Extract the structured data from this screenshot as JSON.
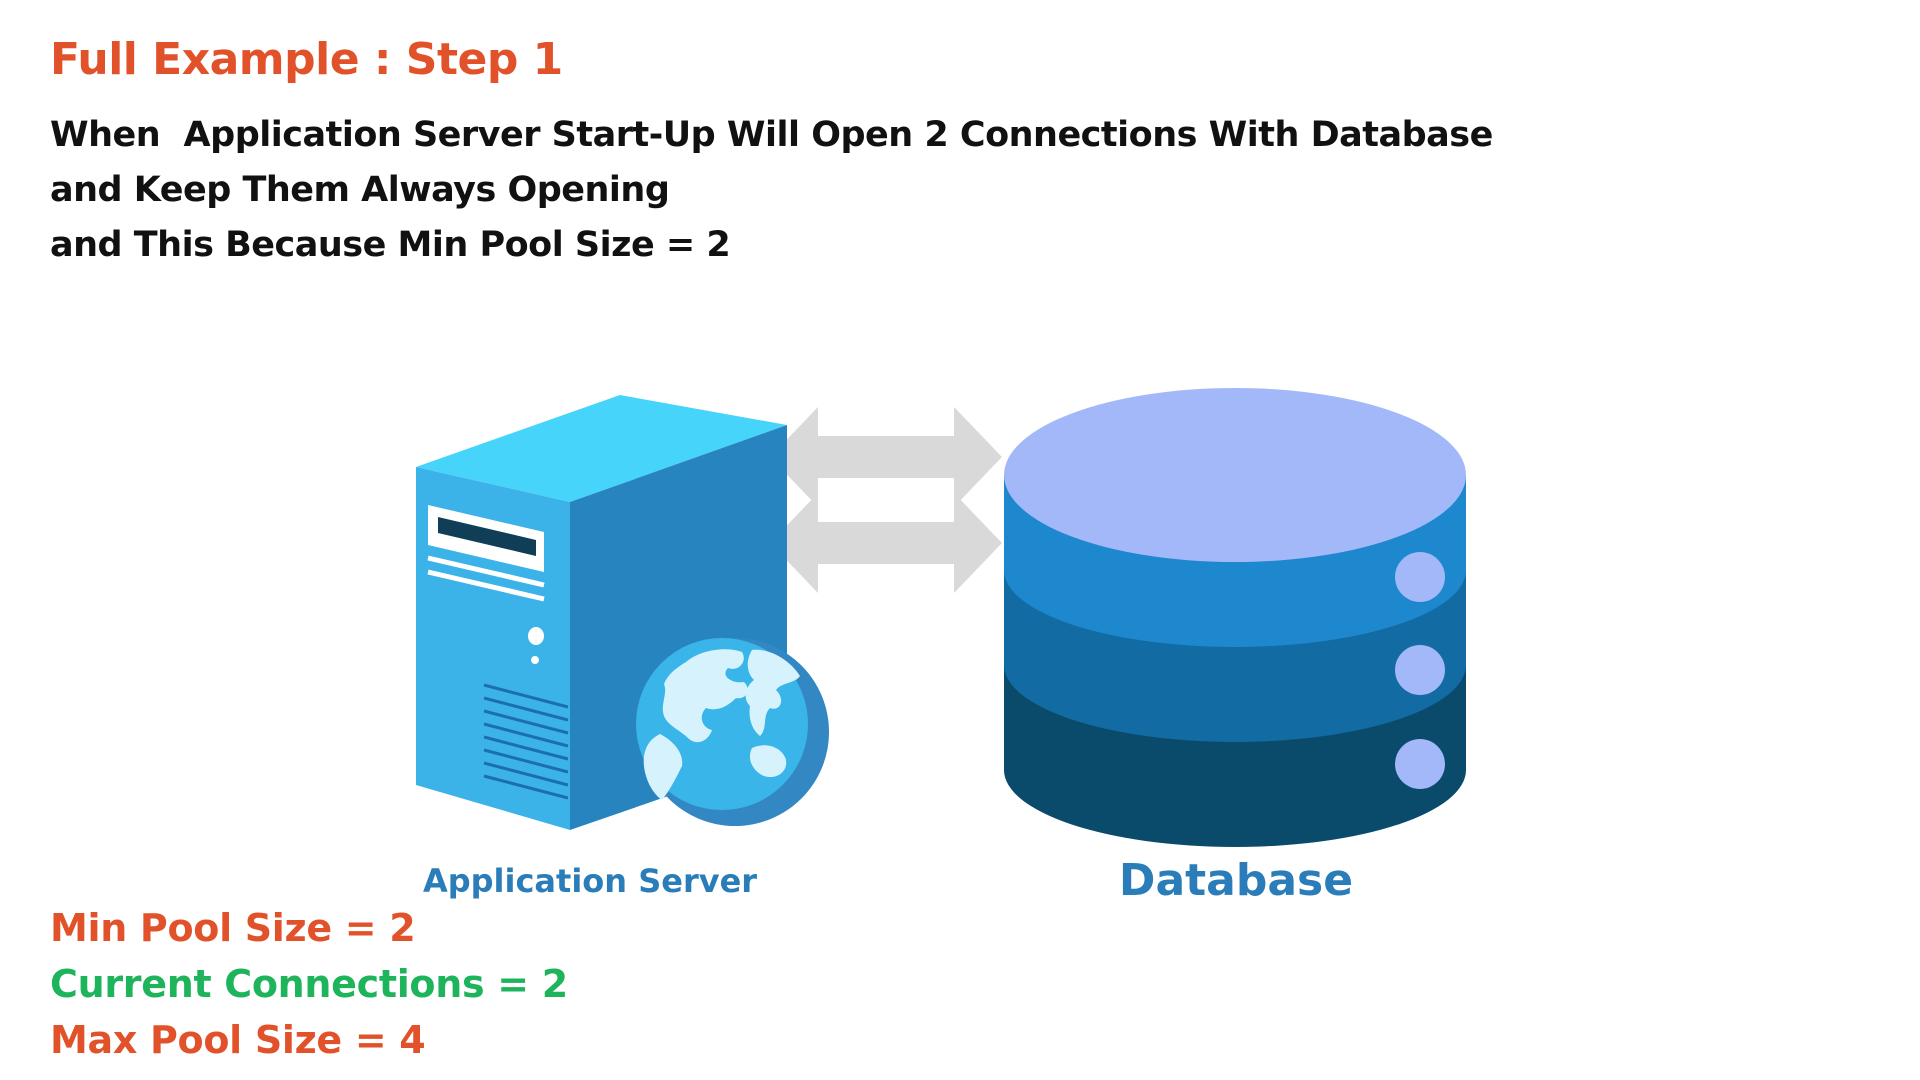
{
  "title": "Full Example : Step 1",
  "description": {
    "lines": [
      "When  Application Server Start-Up Will Open 2 Connections With Database",
      "and Keep Them Always Opening",
      "and This Because Min Pool Size = 2"
    ]
  },
  "diagram": {
    "server_label": "Application Server",
    "database_label": "Database",
    "server_icon": "server-with-globe-icon",
    "database_icon": "database-cylinder-icon",
    "connection_icon": "double-arrow-icon",
    "connections_shown": 2
  },
  "stats": {
    "min_pool": "Min Pool Size = 2",
    "current_connections": "Current Connections = 2",
    "max_pool": "Max Pool Size = 4"
  },
  "colors": {
    "title": "#E2522A",
    "text": "#111111",
    "label_blue": "#2A7DB8",
    "min_pool": "#E2522A",
    "current": "#1DB45C",
    "max_pool": "#E2522A",
    "arrow": "#D9D9D9",
    "server_front": "#3BB3E9",
    "server_side": "#2784BF",
    "server_top": "#47D4FA",
    "db_top": "#A2B8F9",
    "db_layer1": "#1E88CF",
    "db_layer2": "#126BA3",
    "db_layer3": "#0A4A6B",
    "db_dot": "#A2B8F9"
  }
}
